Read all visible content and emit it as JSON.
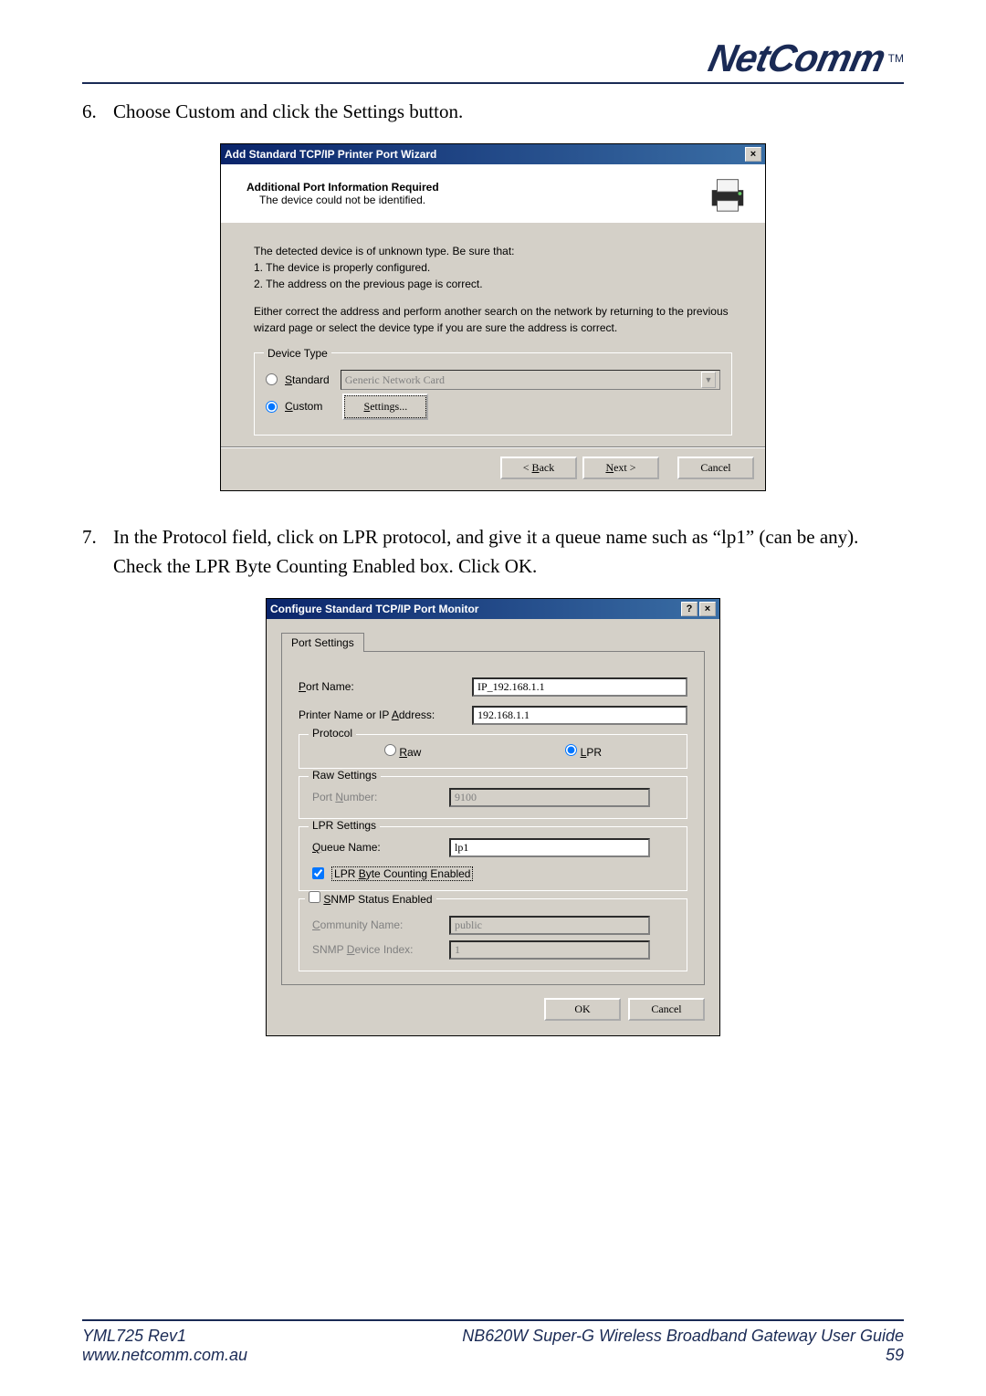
{
  "header": {
    "logo_text": "NetComm",
    "tm": "TM"
  },
  "steps": {
    "s6": {
      "num": "6.",
      "text": "Choose Custom and click the Settings button."
    },
    "s7": {
      "num": "7.",
      "text": "In the Protocol field, click on LPR protocol, and give it a queue name such as “lp1” (can be any).  Check the LPR Byte Counting Enabled box. Click OK."
    }
  },
  "wizard": {
    "title": "Add Standard TCP/IP Printer Port Wizard",
    "close": "×",
    "header_title": "Additional Port Information Required",
    "header_sub": "The device could not be identified.",
    "para1": "The detected device is of unknown type.  Be sure that:",
    "bullet1": "1. The device is properly configured.",
    "bullet2": "2. The address on the previous page is correct.",
    "para2": "Either correct the address and perform another search on the network by returning to the previous wizard page or select the device type if you are sure the address is correct.",
    "device_type_legend": "Device Type",
    "radio_standard_pre": "S",
    "radio_standard_rest": "tandard",
    "combo_value": "Generic Network Card",
    "radio_custom_pre": "C",
    "radio_custom_rest": "ustom",
    "settings_btn_pre": "S",
    "settings_btn_rest": "ettings...",
    "back_btn": "< Back",
    "next_btn": "Next >",
    "cancel_btn": "Cancel"
  },
  "portmon": {
    "title": "Configure Standard TCP/IP Port Monitor",
    "help": "?",
    "close": "×",
    "tab": "Port Settings",
    "port_name_label_pre": "P",
    "port_name_label_rest": "ort Name:",
    "port_name_value": "IP_192.168.1.1",
    "printer_addr_label": "Printer Name or IP Address:",
    "printer_addr_uchar": "A",
    "printer_addr_value": "192.168.1.1",
    "proto_legend": "Protocol",
    "raw_pre": "R",
    "raw_rest": "aw",
    "lpr_pre": "L",
    "lpr_rest": "PR",
    "raw_settings_legend": "Raw Settings",
    "port_number_label": "Port Number:",
    "port_number_uchar": "N",
    "port_number_value": "9100",
    "lpr_settings_legend": "LPR Settings",
    "queue_label_pre": "Q",
    "queue_label_rest": "ueue Name:",
    "queue_value": "lp1",
    "lpr_bc_pre": "L",
    "lpr_bc_mid": "PR ",
    "lpr_bc_u": "B",
    "lpr_bc_rest": "yte Counting Enabled",
    "snmp_pre": "S",
    "snmp_rest": "NMP Status Enabled",
    "community_label": "Community Name:",
    "community_uchar": "C",
    "community_value": "public",
    "devidx_label": "SNMP Device Index:",
    "devidx_uchar": "D",
    "devidx_value": "1",
    "ok_btn": "OK",
    "cancel_btn": "Cancel"
  },
  "footer": {
    "rev": "YML725 Rev1",
    "url": "www.netcomm.com.au",
    "title": "NB620W Super-G Wireless Broadband  Gateway User Guide",
    "page": "59"
  }
}
